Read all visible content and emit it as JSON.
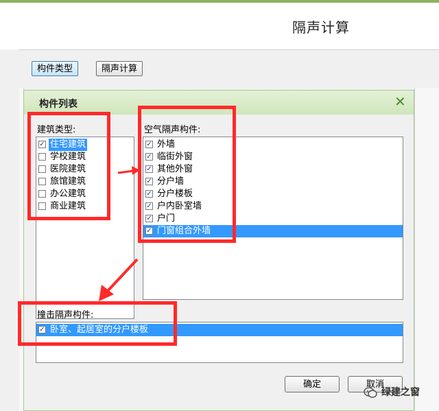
{
  "page": {
    "title": "隔声计算"
  },
  "toolbar": {
    "component_type": "构件类型",
    "sound_calc": "隔声计算"
  },
  "dialog": {
    "title": "构件列表",
    "building_type_label": "建筑类型:",
    "building_types": [
      {
        "label": "住宅建筑",
        "checked": true
      },
      {
        "label": "学校建筑",
        "checked": false
      },
      {
        "label": "医院建筑",
        "checked": false
      },
      {
        "label": "旅馆建筑",
        "checked": false
      },
      {
        "label": "办公建筑",
        "checked": false
      },
      {
        "label": "商业建筑",
        "checked": false
      }
    ],
    "airborne_label": "空气隔声构件:",
    "airborne_items": [
      {
        "label": "外墙",
        "checked": true
      },
      {
        "label": "临街外窗",
        "checked": true
      },
      {
        "label": "其他外窗",
        "checked": true
      },
      {
        "label": "分户墙",
        "checked": true
      },
      {
        "label": "分户楼板",
        "checked": true
      },
      {
        "label": "户内卧室墙",
        "checked": true
      },
      {
        "label": "户门",
        "checked": true
      },
      {
        "label": "门窗组合外墙",
        "checked": true
      }
    ],
    "impact_label": "撞击隔声构件:",
    "impact_items": [
      {
        "label": "卧室、起居室的分户楼板",
        "checked": true
      }
    ],
    "ok": "确定",
    "cancel": "取消"
  },
  "watermark": {
    "text": "绿建之窗"
  },
  "colors": {
    "annotation_red": "#ff2a2a",
    "selection": "#3399ff",
    "title_green": "#cfe6ba"
  }
}
